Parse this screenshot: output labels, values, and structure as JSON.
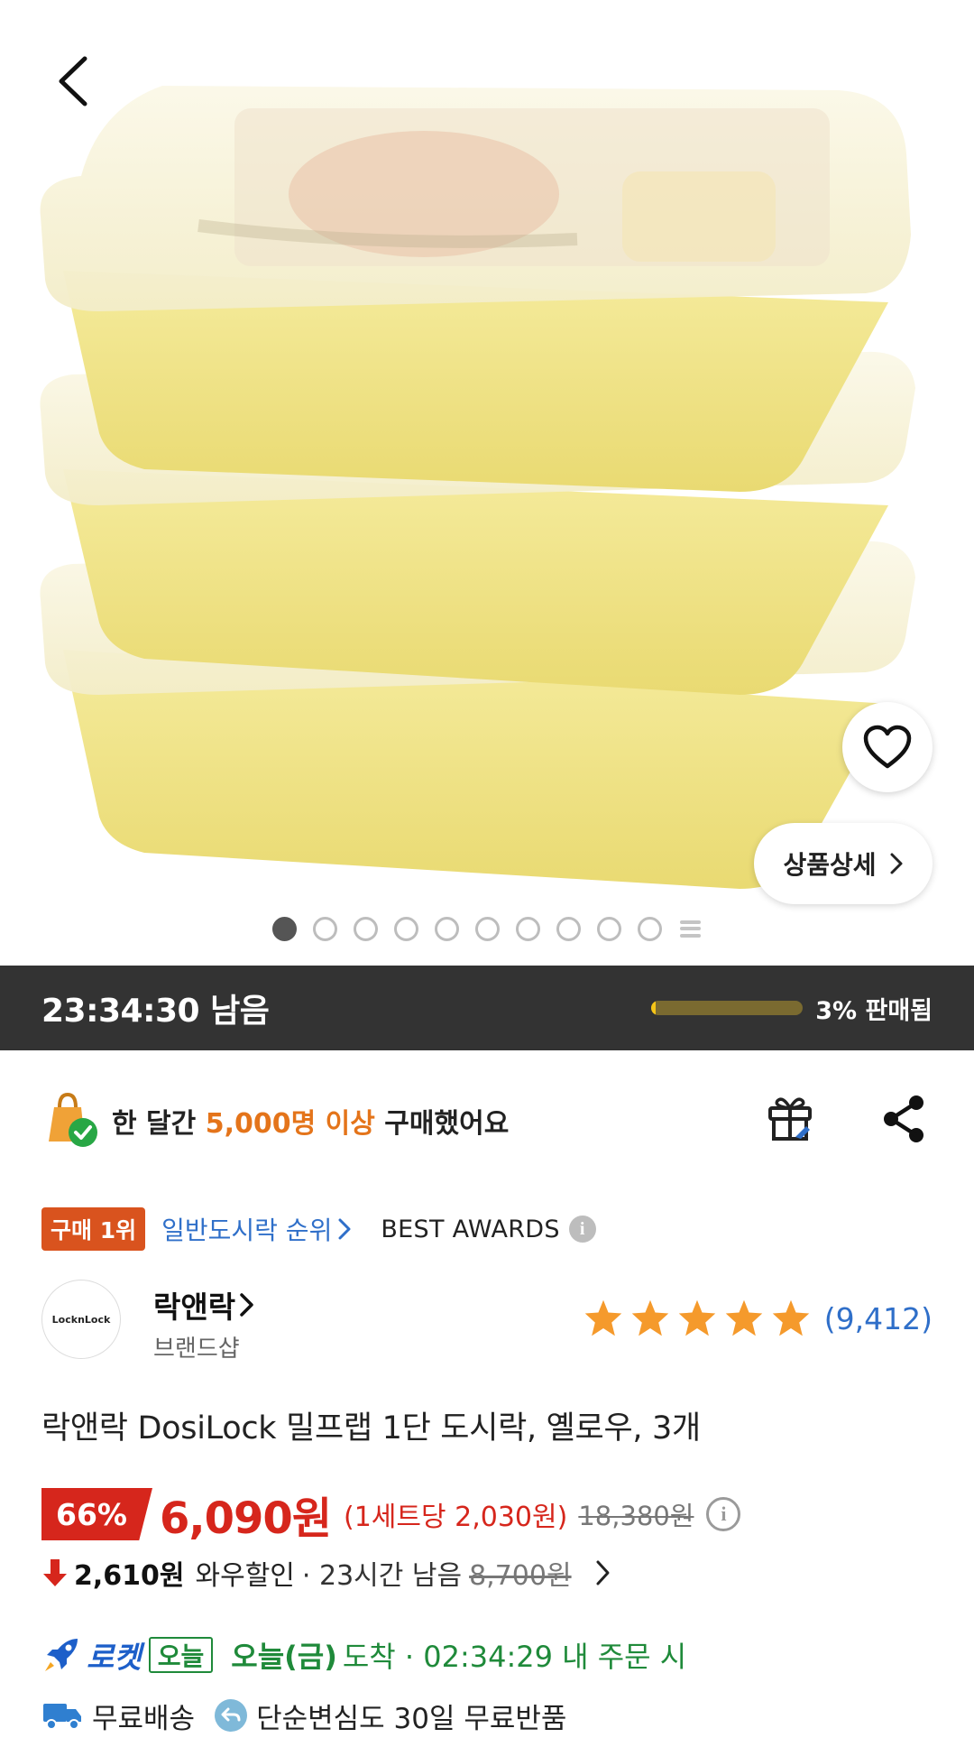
{
  "hero": {
    "back_icon": "chevron-left-icon",
    "favorite_icon": "heart-outline-icon",
    "detail_button_label": "상품상세",
    "image_count": 10,
    "active_image_index": 0
  },
  "deal": {
    "time_left": "23:34:30 남음",
    "sold_fraction": 0.03,
    "sold_label": "3% 판매됨"
  },
  "purchase": {
    "prefix": "한 달간 ",
    "highlight": "5,000명 이상",
    "suffix": " 구매했어요"
  },
  "ranking": {
    "badge": "구매 1위",
    "category_link": "일반도시락 순위",
    "awards": "BEST AWARDS"
  },
  "brand": {
    "logo_text": "LocknLock",
    "name": "락앤락",
    "shop_label": "브랜드샵"
  },
  "rating": {
    "stars": 5,
    "count": "(9,412)"
  },
  "product": {
    "title": "락앤락 DosiLock 밀프랩 1단 도시락, 옐로우, 3개"
  },
  "price": {
    "discount": "66%",
    "sale": "6,090원",
    "unit": "(1세트당 2,030원)",
    "original": "18,380원"
  },
  "wow": {
    "price": "2,610원",
    "label": "와우할인",
    "time": "· 23시간 남음",
    "original": "8,700원"
  },
  "delivery": {
    "rocket_label": "로켓",
    "today_badge": "오늘",
    "arrive_day": "오늘(금)",
    "arrive_rest": "도착 · 02:34:29 내 주문 시",
    "free_shipping": "무료배송",
    "return_policy": "단순변심도 30일 무료반품"
  },
  "colors": {
    "accent_red": "#d6261c",
    "orange": "#e4741a",
    "link_blue": "#2f6fc9",
    "rocket_green": "#1f8a3a",
    "dark_bar": "#333333"
  }
}
